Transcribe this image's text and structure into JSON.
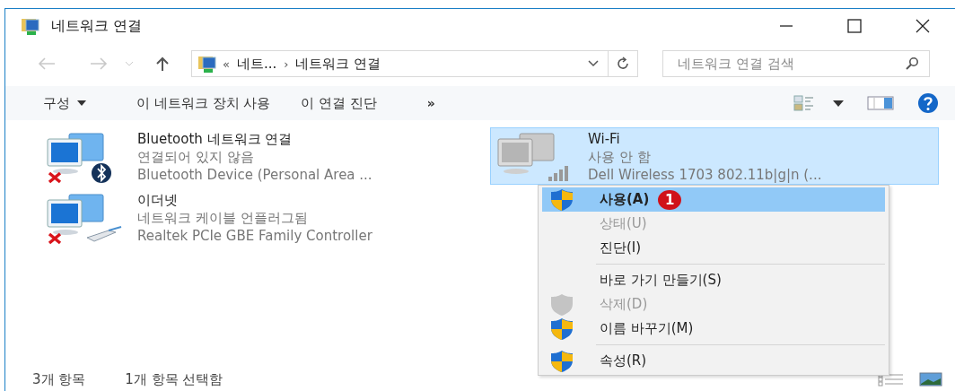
{
  "window": {
    "title": "네트워크 연결"
  },
  "address": {
    "parts": [
      {
        "kind": "chevron",
        "text": "«"
      },
      {
        "kind": "crumb",
        "text": "네트..."
      },
      {
        "kind": "separator",
        "text": "›"
      },
      {
        "kind": "crumb",
        "text": "네트워크 연결"
      }
    ]
  },
  "search": {
    "placeholder": "네트워크 연결 검색"
  },
  "command_bar": {
    "items": [
      {
        "label": "구성",
        "kind": "dropdown"
      },
      {
        "label": "이 네트워크 장치 사용",
        "kind": "button"
      },
      {
        "label": "이 연결 진단",
        "kind": "button"
      },
      {
        "label": "»",
        "kind": "overflow"
      }
    ]
  },
  "connections": [
    {
      "name": "Bluetooth 네트워크 연결",
      "status": "연결되어 있지 않음",
      "device": "Bluetooth Device (Personal Area ...",
      "kind": "bluetooth",
      "disconnected": true,
      "disabled": false,
      "selected": false
    },
    {
      "name": "이더넷",
      "status": "네트워크 케이블 언플러그됨",
      "device": "Realtek PCIe GBE Family Controller",
      "kind": "ethernet",
      "disconnected": true,
      "disabled": false,
      "selected": false
    },
    {
      "name": "Wi-Fi",
      "status": "사용 안 함",
      "device": "Dell Wireless 1703 802.11b|g|n (...",
      "kind": "wifi",
      "disconnected": false,
      "disabled": true,
      "selected": true
    }
  ],
  "context_menu": {
    "items": [
      {
        "kind": "item",
        "label": "사용(A)",
        "shield": true,
        "disabled": false,
        "selected": true,
        "badge": "1"
      },
      {
        "kind": "item",
        "label": "상태(U)",
        "shield": false,
        "disabled": true,
        "selected": false
      },
      {
        "kind": "item",
        "label": "진단(I)",
        "shield": false,
        "disabled": false,
        "selected": false
      },
      {
        "kind": "separator"
      },
      {
        "kind": "item",
        "label": "바로 가기 만들기(S)",
        "shield": false,
        "disabled": false,
        "selected": false
      },
      {
        "kind": "item",
        "label": "삭제(D)",
        "shield": true,
        "disabled": true,
        "selected": false
      },
      {
        "kind": "item",
        "label": "이름 바꾸기(M)",
        "shield": true,
        "disabled": false,
        "selected": false
      },
      {
        "kind": "separator"
      },
      {
        "kind": "item",
        "label": "속성(R)",
        "shield": true,
        "disabled": false,
        "selected": false
      }
    ]
  },
  "status_bar": {
    "items": [
      "3개 항목",
      "1개 항목 선택함"
    ]
  }
}
